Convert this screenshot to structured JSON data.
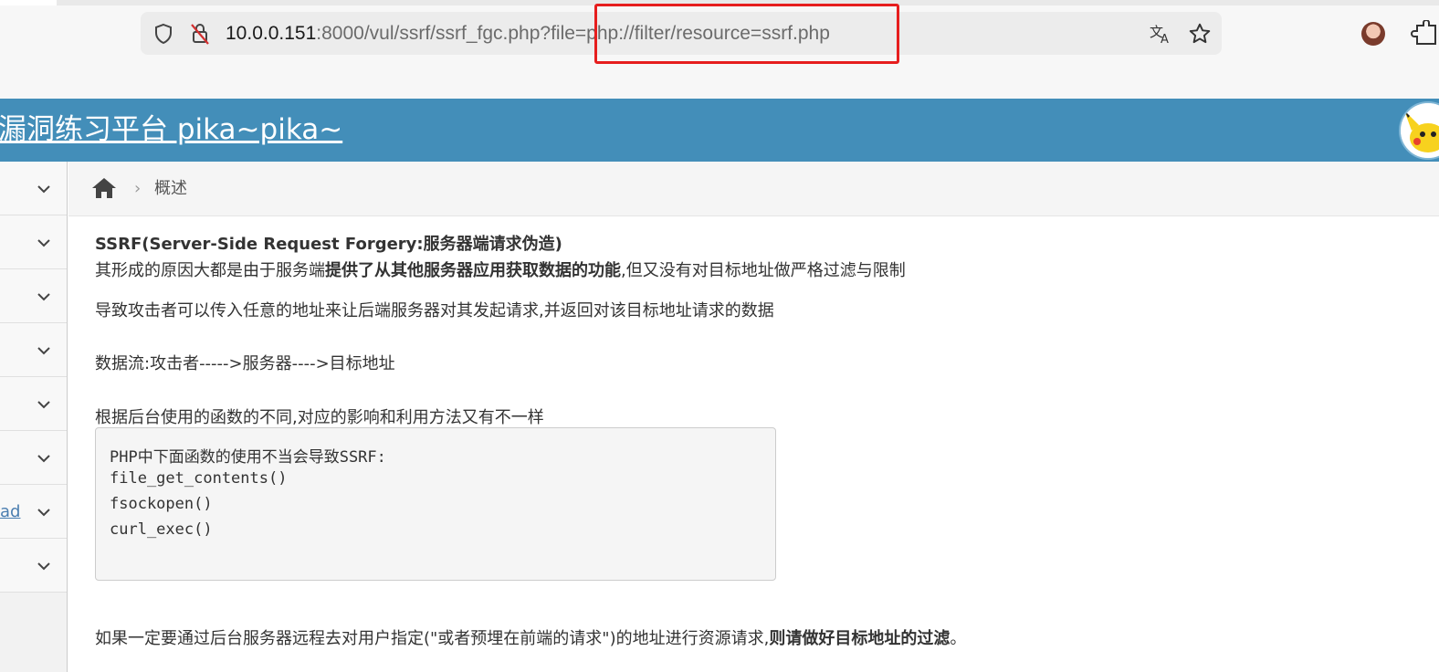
{
  "browser": {
    "url_host": "10.0.0.151",
    "url_rest": ":8000/vul/ssrf/ssrf_fgc.php?file=php://filter/resource=ssrf.php",
    "icons": [
      "shield-icon",
      "insecure-lock-icon",
      "translate-icon",
      "star-icon",
      "avatar",
      "extensions-icon"
    ]
  },
  "header": {
    "title": "漏洞练习平台 pika~pika~"
  },
  "sidebar": {
    "items": [
      {
        "label": ""
      },
      {
        "label": ""
      },
      {
        "label": ""
      },
      {
        "label": ""
      },
      {
        "label": ""
      },
      {
        "label": ""
      },
      {
        "label": "ad"
      },
      {
        "label": ""
      }
    ]
  },
  "breadcrumb": {
    "separator": "›",
    "current": "概述"
  },
  "content": {
    "heading": "SSRF(Server-Side Request Forgery:服务器端请求伪造)",
    "line1_pre": "其形成的原因大都是由于服务端",
    "line1_bold": "提供了从其他服务器应用获取数据的功能",
    "line1_post": ",但又没有对目标地址做严格过滤与限制",
    "line2": "导致攻击者可以传入任意的地址来让后端服务器对其发起请求,并返回对该目标地址请求的数据",
    "line3": "数据流:攻击者----->服务器---->目标地址",
    "line4": "根据后台使用的函数的不同,对应的影响和利用方法又有不一样",
    "code": [
      "PHP中下面函数的使用不当会导致SSRF:",
      "file_get_contents()",
      "fsockopen()",
      "curl_exec()"
    ],
    "final_pre": "如果一定要通过后台服务器远程去对用户指定(\"或者预埋在前端的请求\")的地址进行资源请求,",
    "final_bold": "则请做好目标地址的过滤",
    "final_post": "。"
  },
  "colors": {
    "header_bg": "#438eb9",
    "highlight": "#e61e1e"
  }
}
